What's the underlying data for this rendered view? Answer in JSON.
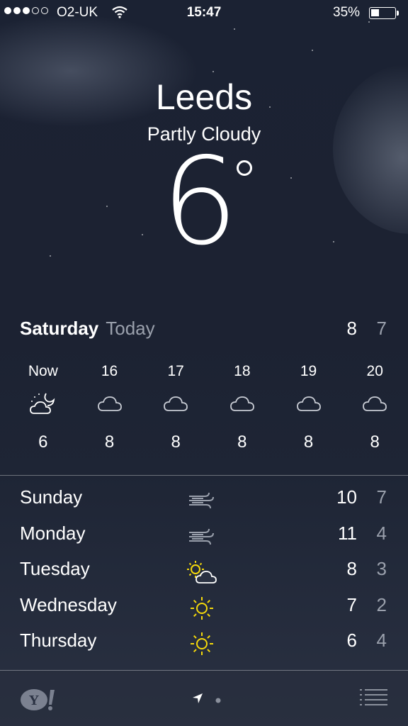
{
  "status_bar": {
    "carrier": "O2-UK",
    "time": "15:47",
    "battery_percent": "35%",
    "battery_level": 0.35,
    "signal_bars": 3,
    "signal_total": 5
  },
  "location": {
    "city": "Leeds",
    "condition": "Partly Cloudy",
    "temperature": "6"
  },
  "today": {
    "day": "Saturday",
    "label": "Today",
    "high": "8",
    "low": "7"
  },
  "hourly": [
    {
      "time": "Now",
      "icon": "partly-cloudy-night-icon",
      "temp": "6"
    },
    {
      "time": "16",
      "icon": "cloud-icon",
      "temp": "8"
    },
    {
      "time": "17",
      "icon": "cloud-icon",
      "temp": "8"
    },
    {
      "time": "18",
      "icon": "cloud-icon",
      "temp": "8"
    },
    {
      "time": "19",
      "icon": "cloud-icon",
      "temp": "8"
    },
    {
      "time": "20",
      "icon": "cloud-icon",
      "temp": "8"
    }
  ],
  "daily": [
    {
      "day": "Sunday",
      "icon": "wind-icon",
      "high": "10",
      "low": "7"
    },
    {
      "day": "Monday",
      "icon": "wind-icon",
      "high": "11",
      "low": "4"
    },
    {
      "day": "Tuesday",
      "icon": "partly-sunny-icon",
      "high": "8",
      "low": "3"
    },
    {
      "day": "Wednesday",
      "icon": "sun-icon",
      "high": "7",
      "low": "2"
    },
    {
      "day": "Thursday",
      "icon": "sun-icon",
      "high": "6",
      "low": "4"
    }
  ],
  "colors": {
    "sun_yellow": "#f5d90a",
    "secondary_text": "#9aa0ac"
  },
  "toolbar": {
    "logo_icon": "yahoo-logo-icon",
    "location_icon": "location-arrow-icon",
    "page_dot_icon": "page-indicator-dot",
    "menu_icon": "list-menu-icon"
  }
}
